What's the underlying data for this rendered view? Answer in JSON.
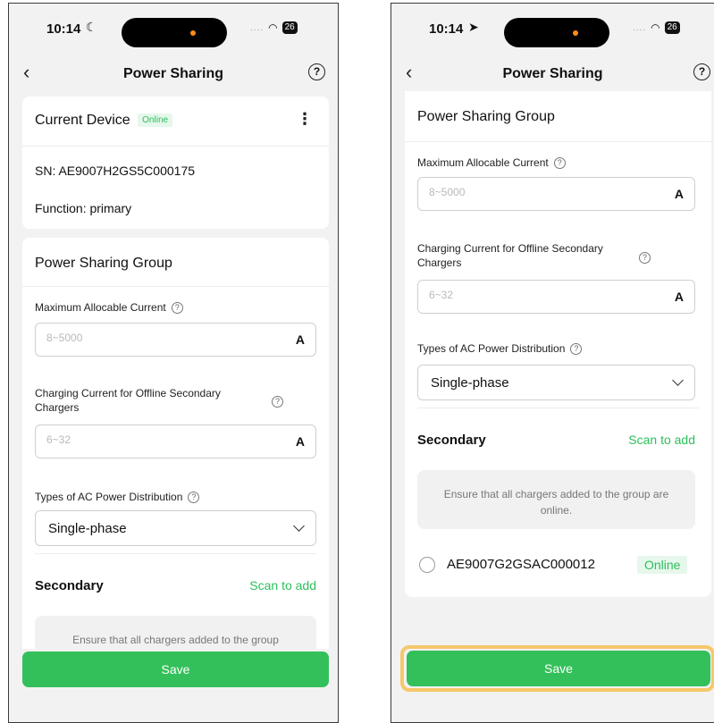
{
  "left": {
    "status": {
      "time": "10:14",
      "battery": "26"
    },
    "nav": {
      "title": "Power Sharing"
    },
    "current_device": {
      "title": "Current Device",
      "status": "Online",
      "sn": "SN: AE9007H2GS5C000175",
      "function": "Function: primary"
    },
    "group": {
      "title": "Power Sharing Group",
      "max_current_label": "Maximum Allocable Current",
      "max_current_placeholder": "8~5000",
      "max_current_unit": "A",
      "offline_label_line1": "Charging Current for Offline Secondary",
      "offline_label_line2": "Chargers",
      "offline_placeholder": "6~32",
      "offline_unit": "A",
      "ac_label": "Types of AC Power Distribution",
      "ac_value": "Single-phase",
      "secondary_title": "Secondary",
      "scan_label": "Scan to add",
      "notice": "Ensure that all chargers added to the group"
    },
    "save_label": "Save"
  },
  "right": {
    "status": {
      "time": "10:14",
      "battery": "26"
    },
    "nav": {
      "title": "Power Sharing"
    },
    "group": {
      "title": "Power Sharing Group",
      "max_current_label": "Maximum Allocable Current",
      "max_current_placeholder": "8~5000",
      "max_current_unit": "A",
      "offline_label_line1": "Charging Current for Offline Secondary",
      "offline_label_line2": "Chargers",
      "offline_placeholder": "6~32",
      "offline_unit": "A",
      "ac_label": "Types of AC Power Distribution",
      "ac_value": "Single-phase",
      "secondary_title": "Secondary",
      "scan_label": "Scan to add",
      "notice": "Ensure that all chargers added to the group are online.",
      "device_sn": "AE9007G2GSAC000012",
      "device_status": "Online"
    },
    "save_label": "Save"
  },
  "icons": {
    "back": "‹",
    "help": "?",
    "more": "⋮"
  },
  "colors": {
    "accent_green": "#33c05a",
    "online_text": "#2dbf5c",
    "highlight": "#f5c86b"
  }
}
